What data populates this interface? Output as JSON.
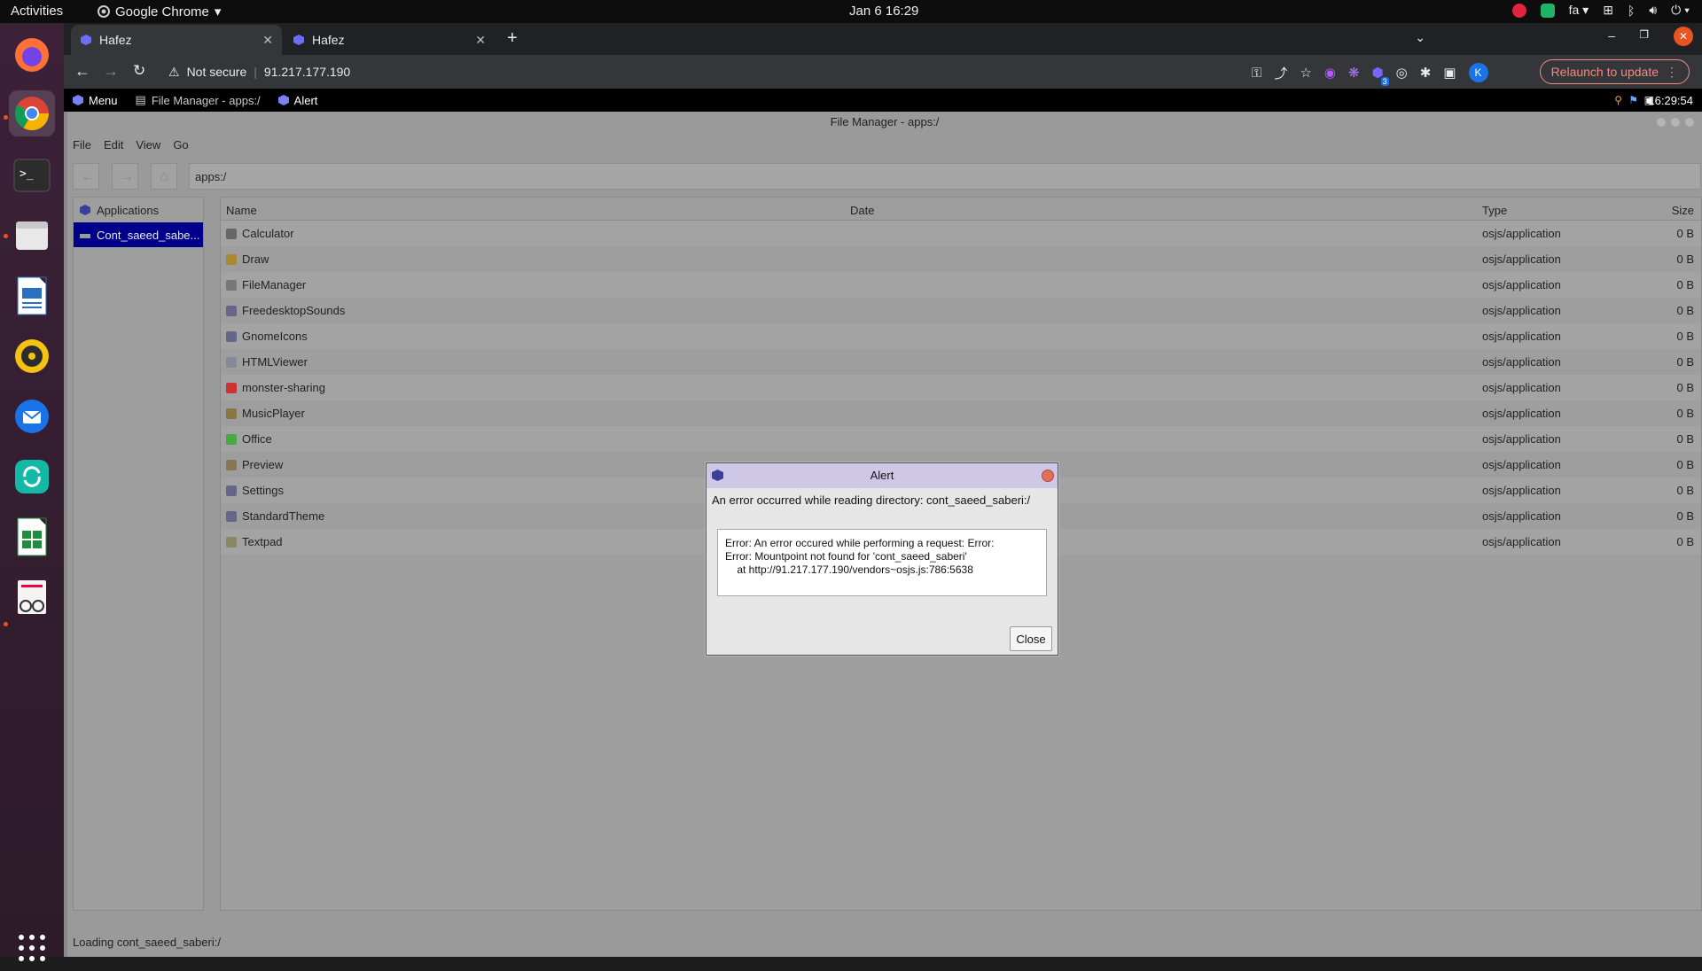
{
  "topbar": {
    "activities": "Activities",
    "app_name": "Google Chrome",
    "clock": "Jan 6  16:29",
    "lang": "fa"
  },
  "chrome": {
    "tabs": [
      {
        "title": "Hafez"
      },
      {
        "title": "Hafez"
      }
    ],
    "security": "Not secure",
    "url": "91.217.177.190",
    "relaunch": "Relaunch to update",
    "profile": "K",
    "ext_badge": "3"
  },
  "osjs": {
    "panel": {
      "menu": "Menu",
      "items": [
        "File Manager - apps:/",
        "Alert"
      ],
      "clock": "16:29:54"
    },
    "filemanager": {
      "title": "File Manager - apps:/",
      "menu": [
        "File",
        "Edit",
        "View",
        "Go"
      ],
      "path": "apps:/",
      "sidebar": [
        "Applications",
        "Cont_saeed_sabe..."
      ],
      "columns": {
        "name": "Name",
        "date": "Date",
        "type": "Type",
        "size": "Size"
      },
      "rows": [
        {
          "name": "Calculator",
          "type": "osjs/application",
          "size": "0 B"
        },
        {
          "name": "Draw",
          "type": "osjs/application",
          "size": "0 B"
        },
        {
          "name": "FileManager",
          "type": "osjs/application",
          "size": "0 B"
        },
        {
          "name": "FreedesktopSounds",
          "type": "osjs/application",
          "size": "0 B"
        },
        {
          "name": "GnomeIcons",
          "type": "osjs/application",
          "size": "0 B"
        },
        {
          "name": "HTMLViewer",
          "type": "osjs/application",
          "size": "0 B"
        },
        {
          "name": "monster-sharing",
          "type": "osjs/application",
          "size": "0 B"
        },
        {
          "name": "MusicPlayer",
          "type": "osjs/application",
          "size": "0 B"
        },
        {
          "name": "Office",
          "type": "osjs/application",
          "size": "0 B"
        },
        {
          "name": "Preview",
          "type": "osjs/application",
          "size": "0 B"
        },
        {
          "name": "Settings",
          "type": "osjs/application",
          "size": "0 B"
        },
        {
          "name": "StandardTheme",
          "type": "osjs/application",
          "size": "0 B"
        },
        {
          "name": "Textpad",
          "type": "osjs/application",
          "size": "0 B"
        }
      ],
      "status": "Loading cont_saeed_saberi:/"
    },
    "alert": {
      "title": "Alert",
      "message": "An error occurred while reading directory: cont_saeed_saberi:/",
      "detail": "Error: An error occured while performing a request: Error:\nError: Mountpoint not found for 'cont_saeed_saberi'\n    at http://91.217.177.190/vendors~osjs.js:786:5638",
      "close": "Close"
    }
  }
}
